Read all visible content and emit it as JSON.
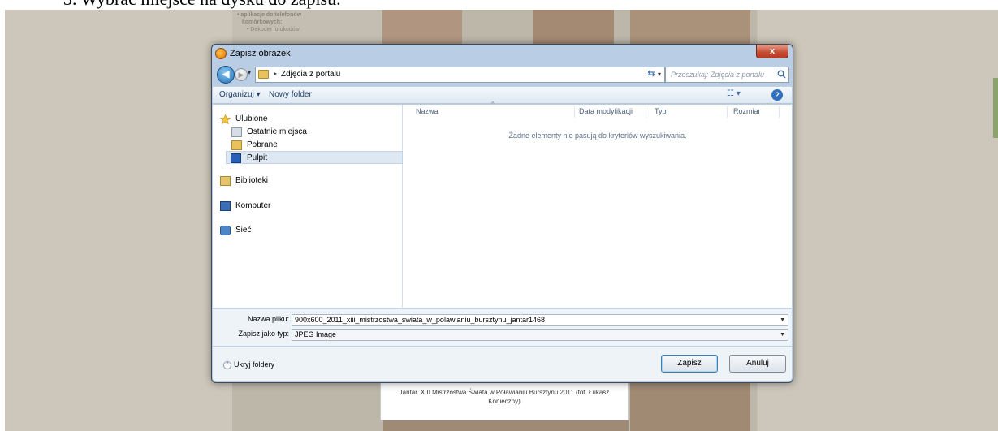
{
  "document": {
    "heading": "3.  Wybrać miejsce na dysku do zapisu."
  },
  "background_page": {
    "menu": [
      "• aplikacje do telefonów",
      "komórkowych:",
      "• Dekoder fotokodów"
    ],
    "caption": "Jantar. XIII Mistrzostwa Świata w Poławianiu Bursztynu 2011 (fot. Łukasz Konieczny)"
  },
  "dialog": {
    "title": "Zapisz obrazek",
    "close_label": "x",
    "address": {
      "path": "Zdjęcia z portalu",
      "search_placeholder": "Przeszukaj: Zdjęcia z portalu"
    },
    "toolbar": {
      "organize": "Organizuj ▾",
      "new_folder": "Nowy folder"
    },
    "nav": {
      "favorites": "Ulubione",
      "recent": "Ostatnie miejsca",
      "downloads": "Pobrane",
      "desktop": "Pulpit",
      "libraries": "Biblioteki",
      "computer": "Komputer",
      "network": "Sieć"
    },
    "columns": [
      "Nazwa",
      "Data modyfikacji",
      "Typ",
      "Rozmiar"
    ],
    "empty_message": "Żadne elementy nie pasują do kryteriów wyszukiwania.",
    "filename_label": "Nazwa pliku:",
    "filename_value": "900x600_2011_xiii_mistrzostwa_swiata_w_polawianiu_bursztynu_jantar1468",
    "filetype_label": "Zapisz jako typ:",
    "filetype_value": "JPEG Image",
    "hide_folders": "Ukryj foldery",
    "save_button": "Zapisz",
    "cancel_button": "Anuluj"
  }
}
